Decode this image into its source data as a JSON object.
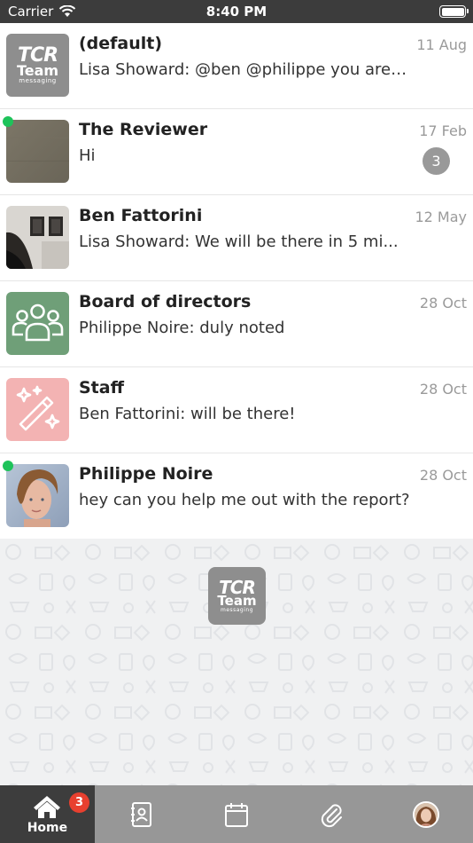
{
  "status_bar": {
    "carrier": "Carrier",
    "time": "8:40 PM",
    "battery_level": 1.0
  },
  "conversations": [
    {
      "name": "(default)",
      "preview": "Lisa Showard: @ben @philippe you are g...",
      "date": "11 Aug",
      "online": false,
      "unread": null,
      "avatar": "tcr-team-logo",
      "logo_line1": "TCR",
      "logo_line2": "Team",
      "logo_line3": "messaging"
    },
    {
      "name": "The Reviewer",
      "preview": "Hi",
      "date": "17 Feb",
      "online": true,
      "unread": "3",
      "avatar": "photo-gray-texture"
    },
    {
      "name": "Ben Fattorini",
      "preview": "Lisa Showard: We will be there in 5 mi...",
      "date": "12 May",
      "online": false,
      "unread": null,
      "avatar": "photo-frames-on-wall"
    },
    {
      "name": "Board of directors",
      "preview": "Philippe Noire: duly noted",
      "date": "28 Oct",
      "online": false,
      "unread": null,
      "avatar": "group-icon"
    },
    {
      "name": "Staff",
      "preview": "Ben Fattorini: will be there!",
      "date": "28 Oct",
      "online": false,
      "unread": null,
      "avatar": "magic-wand-icon"
    },
    {
      "name": "Philippe Noire",
      "preview": "hey can you help me out with the report?",
      "date": "28 Oct",
      "online": true,
      "unread": null,
      "avatar": "photo-portrait"
    }
  ],
  "center_logo": {
    "line1": "TCR",
    "line2": "Team",
    "line3": "messaging"
  },
  "tab_bar": {
    "tabs": [
      {
        "id": "home",
        "label": "Home",
        "icon": "home-icon",
        "active": true,
        "badge": "3"
      },
      {
        "id": "contacts",
        "label": "",
        "icon": "contacts-icon",
        "active": false
      },
      {
        "id": "calendar",
        "label": "",
        "icon": "calendar-icon",
        "active": false
      },
      {
        "id": "attachments",
        "label": "",
        "icon": "paperclip-icon",
        "active": false
      },
      {
        "id": "profile",
        "label": "",
        "icon": "profile-avatar",
        "active": false
      }
    ]
  },
  "colors": {
    "status_bar": "#3c3c3c",
    "online": "#1ec35a",
    "badge": "#e8402f",
    "tab_bar": "#979797",
    "tab_active": "#3d3d3d",
    "board_avatar": "#6f9f78",
    "staff_avatar": "#f3b3b3"
  }
}
